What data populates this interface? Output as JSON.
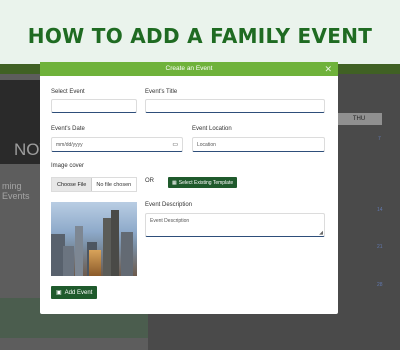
{
  "headline": "HOW TO ADD A FAMILY EVENT",
  "background": {
    "hero_text": "NOV",
    "upcoming_text": "ming Events",
    "calendar_day_header": "THU",
    "calendar_numbers": [
      "7",
      "14",
      "21",
      "28"
    ]
  },
  "modal": {
    "title": "Create an Event",
    "close_icon": "close-icon",
    "select_event_label": "Select Event",
    "events_title_label": "Event's Title",
    "events_date_label": "Event's Date",
    "event_location_label": "Event Location",
    "date_placeholder": "mm/dd/yyyy",
    "location_placeholder": "Location",
    "image_cover_label": "Image cover",
    "choose_file_label": "Choose File",
    "no_file_text": "No file chosen",
    "or_text": "OR",
    "select_template_label": "Select Existing Template",
    "event_description_label": "Event Description",
    "description_placeholder": "Event Description",
    "add_event_label": "Add Event"
  },
  "colors": {
    "headline": "#1f6b22",
    "modal_header": "#6fb23b",
    "primary_button": "#1f5a2c"
  }
}
